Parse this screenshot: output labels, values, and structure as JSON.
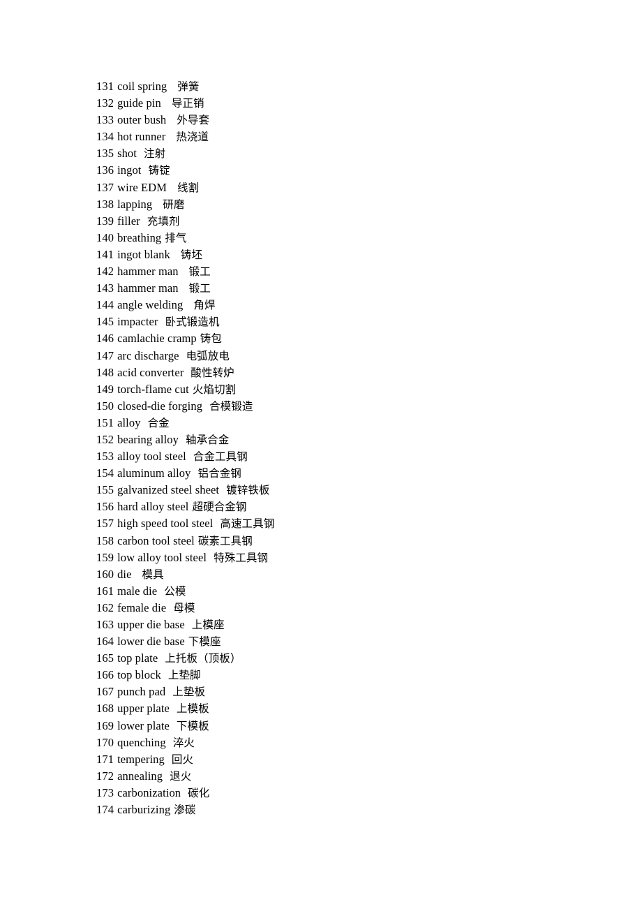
{
  "document": {
    "type": "bilingual-glossary",
    "language_pair": "English-Chinese",
    "entries": [
      {
        "number": "131",
        "english": "coil spring",
        "chinese": "弹簧",
        "gap": "gap-l"
      },
      {
        "number": "132",
        "english": "guide pin",
        "chinese": "导正销",
        "gap": "gap-l"
      },
      {
        "number": "133",
        "english": "outer bush",
        "chinese": "外导套",
        "gap": "gap-l"
      },
      {
        "number": "134",
        "english": "hot runner",
        "chinese": "热浇道",
        "gap": "gap-l"
      },
      {
        "number": "135",
        "english": "shot",
        "chinese": "注射",
        "gap": "gap-m"
      },
      {
        "number": "136",
        "english": "ingot",
        "chinese": "铸锭",
        "gap": "gap-m"
      },
      {
        "number": "137",
        "english": "wire EDM",
        "chinese": "线割",
        "gap": "gap-l"
      },
      {
        "number": "138",
        "english": "lapping",
        "chinese": "研磨",
        "gap": "gap-l"
      },
      {
        "number": "139",
        "english": "filler",
        "chinese": "充填剂",
        "gap": "gap-m"
      },
      {
        "number": "140",
        "english": "breathing",
        "chinese": "排气",
        "gap": "gap-s"
      },
      {
        "number": "141",
        "english": "ingot blank",
        "chinese": "铸坯",
        "gap": "gap-l"
      },
      {
        "number": "142",
        "english": "hammer man",
        "chinese": "锻工",
        "gap": "gap-l"
      },
      {
        "number": "143",
        "english": "hammer man",
        "chinese": "锻工",
        "gap": "gap-l"
      },
      {
        "number": "144",
        "english": "angle welding",
        "chinese": "角焊",
        "gap": "gap-l"
      },
      {
        "number": "145",
        "english": "impacter",
        "chinese": "卧式锻造机",
        "gap": "gap-m"
      },
      {
        "number": "146",
        "english": "camlachie cramp",
        "chinese": "铸包",
        "gap": "gap-s"
      },
      {
        "number": "147",
        "english": "arc discharge",
        "chinese": "电弧放电",
        "gap": "gap-m"
      },
      {
        "number": "148",
        "english": "acid converter",
        "chinese": "酸性转炉",
        "gap": "gap-m"
      },
      {
        "number": "149",
        "english": "torch-flame cut",
        "chinese": "火焰切割",
        "gap": "gap-s"
      },
      {
        "number": "150",
        "english": "closed-die forging",
        "chinese": "合模锻造",
        "gap": "gap-m"
      },
      {
        "number": "151",
        "english": "alloy",
        "chinese": "合金",
        "gap": "gap-m"
      },
      {
        "number": "152",
        "english": "bearing alloy",
        "chinese": "轴承合金",
        "gap": "gap-m"
      },
      {
        "number": "153",
        "english": "alloy tool steel",
        "chinese": "合金工具钢",
        "gap": "gap-m"
      },
      {
        "number": "154",
        "english": "aluminum alloy",
        "chinese": "铝合金钢",
        "gap": "gap-m"
      },
      {
        "number": "155",
        "english": "galvanized steel sheet",
        "chinese": "镀锌铁板",
        "gap": "gap-m"
      },
      {
        "number": "156",
        "english": "hard alloy steel",
        "chinese": "超硬合金钢",
        "gap": "gap-s"
      },
      {
        "number": "157",
        "english": "high speed tool steel",
        "chinese": "高速工具钢",
        "gap": "gap-m"
      },
      {
        "number": "158",
        "english": "carbon tool steel",
        "chinese": "碳素工具钢",
        "gap": "gap-s"
      },
      {
        "number": "159",
        "english": "low alloy tool steel",
        "chinese": "特殊工具钢",
        "gap": "gap-m"
      },
      {
        "number": "160",
        "english": "die",
        "chinese": "模具",
        "gap": "gap-l"
      },
      {
        "number": "161",
        "english": "male die",
        "chinese": "公模",
        "gap": "gap-m"
      },
      {
        "number": "162",
        "english": "female die",
        "chinese": "母模",
        "gap": "gap-m"
      },
      {
        "number": "163",
        "english": "upper die base",
        "chinese": "上模座",
        "gap": "gap-m"
      },
      {
        "number": "164",
        "english": "lower die base",
        "chinese": "下模座",
        "gap": "gap-s"
      },
      {
        "number": "165",
        "english": "top plate",
        "chinese": "上托板（顶板）",
        "gap": "gap-m"
      },
      {
        "number": "166",
        "english": "top block",
        "chinese": "上垫脚",
        "gap": "gap-m"
      },
      {
        "number": "167",
        "english": "punch pad",
        "chinese": "上垫板",
        "gap": "gap-m"
      },
      {
        "number": "168",
        "english": "upper plate",
        "chinese": "上模板",
        "gap": "gap-m"
      },
      {
        "number": "169",
        "english": "lower plate",
        "chinese": "下模板",
        "gap": "gap-m"
      },
      {
        "number": "170",
        "english": "quenching",
        "chinese": "淬火",
        "gap": "gap-m"
      },
      {
        "number": "171",
        "english": "tempering",
        "chinese": "回火",
        "gap": "gap-m"
      },
      {
        "number": "172",
        "english": "annealing",
        "chinese": "退火",
        "gap": "gap-m"
      },
      {
        "number": "173",
        "english": "carbonization",
        "chinese": "碳化",
        "gap": "gap-m"
      },
      {
        "number": "174",
        "english": "carburizing",
        "chinese": "渗碳",
        "gap": "gap-s"
      }
    ]
  }
}
